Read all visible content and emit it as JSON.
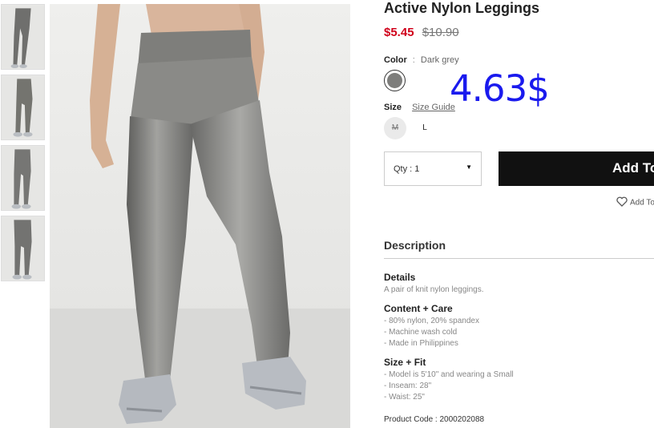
{
  "product": {
    "title": "Active Nylon Leggings",
    "sale_price": "$5.45",
    "original_price": "$10.90",
    "overlay_price": "4.63$"
  },
  "color": {
    "label": "Color",
    "separator": ":",
    "value": "Dark grey",
    "swatch_color": "#7d7d7b"
  },
  "size": {
    "label": "Size",
    "guide_label": "Size Guide",
    "options": [
      {
        "label": "M",
        "available": false
      },
      {
        "label": "L",
        "available": true
      }
    ]
  },
  "quantity": {
    "label": "Qty : 1"
  },
  "actions": {
    "add_label": "Add To Bag",
    "wishlist_label": "Add To Wishlist"
  },
  "description": {
    "heading": "Description",
    "details_title": "Details",
    "details_text": "A pair of knit nylon leggings.",
    "content_title": "Content + Care",
    "content_lines": [
      "- 80% nylon, 20% spandex",
      "- Machine wash cold",
      "- Made in Philippines"
    ],
    "fit_title": "Size + Fit",
    "fit_lines": [
      "- Model is 5'10\" and wearing a Small",
      "- Inseam: 28\"",
      "- Waist: 25\""
    ],
    "product_code": "Product Code : 2000202088"
  },
  "colors": {
    "sale": "#d0021b",
    "button": "#111111",
    "overlay": "#1a1aee"
  }
}
